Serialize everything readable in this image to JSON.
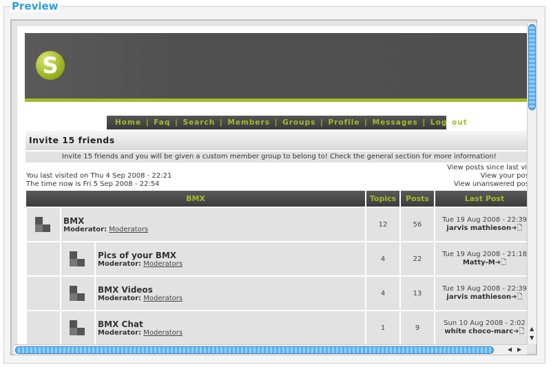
{
  "panel": {
    "legend": "Preview"
  },
  "logo": {
    "letter": "S"
  },
  "nav": {
    "items": [
      "Home",
      "Faq",
      "Search",
      "Members",
      "Groups",
      "Profile",
      "Messages",
      "Log out"
    ]
  },
  "announcement": {
    "title": "Invite 15 friends",
    "message": "Invite 15 friends and you will be given a custom member group to belong to! Check the general section for more information!"
  },
  "visit": {
    "last_visit": "You last visited on Thu 4 Sep 2008 - 22:21",
    "now": "The time now is Fri 5 Sep 2008 - 22:54",
    "links": [
      "View posts since last visit",
      "View your posts",
      "View unanswered posts"
    ]
  },
  "table": {
    "headers": {
      "forum": "BMX",
      "topics": "Topics",
      "posts": "Posts",
      "last_post": "Last Post"
    },
    "moderator_label": "Moderator:",
    "rows": [
      {
        "name": "BMX",
        "moderator": "Moderators",
        "topics": "12",
        "posts": "56",
        "date": "Tue 19 Aug 2008 - 22:39",
        "user": "jarvis mathieson",
        "sub": false
      },
      {
        "name": "Pics of your BMX",
        "moderator": "Moderators",
        "topics": "4",
        "posts": "22",
        "date": "Tue 19 Aug 2008 - 21:18",
        "user": "Matty-M",
        "sub": true
      },
      {
        "name": "BMX Videos",
        "moderator": "Moderators",
        "topics": "4",
        "posts": "13",
        "date": "Tue 19 Aug 2008 - 22:39",
        "user": "jarvis mathieson",
        "sub": true
      },
      {
        "name": "BMX Chat",
        "moderator": "Moderators",
        "topics": "1",
        "posts": "9",
        "date": "Sun 10 Aug 2008 - 2:02",
        "user": "white choco-marc",
        "sub": true
      }
    ]
  },
  "colors": {
    "accent": "#a3bb2a",
    "header": "#505050",
    "legend": "#2b9fd4"
  }
}
